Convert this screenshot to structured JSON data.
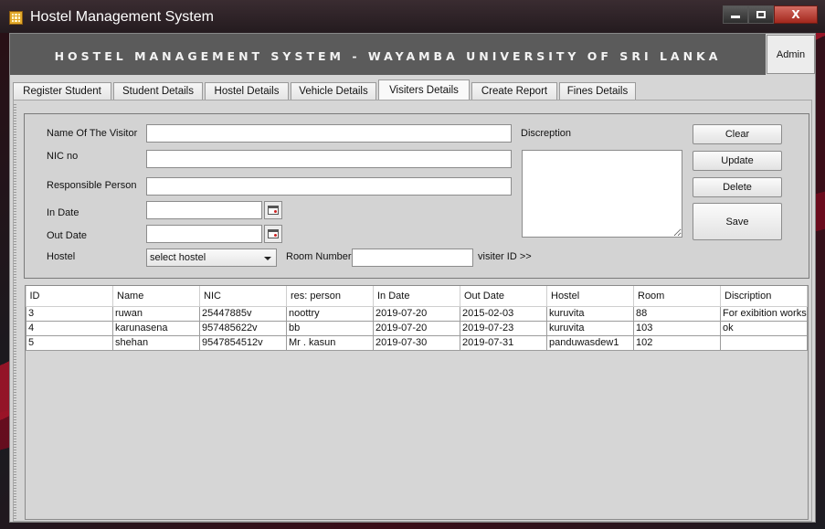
{
  "window": {
    "title": "Hostel Management System",
    "min_glyph": "",
    "max_glyph": "",
    "close_glyph": "X"
  },
  "banner": {
    "title": "HOSTEL MANAGEMENT SYSTEM - WAYAMBA UNIVERSITY OF SRI LANKA",
    "admin_label": "Admin"
  },
  "tabs": [
    {
      "label": "Register Student"
    },
    {
      "label": "Student Details"
    },
    {
      "label": "Hostel Details"
    },
    {
      "label": "Vehicle Details"
    },
    {
      "label": "Visiters Details",
      "active": true
    },
    {
      "label": "Create Report"
    },
    {
      "label": "Fines Details"
    }
  ],
  "form": {
    "visitor_name_label": "Name Of The Visitor",
    "visitor_name_value": "",
    "nic_label": "NIC no",
    "nic_value": "",
    "responsible_label": "Responsible Person",
    "responsible_value": "",
    "in_date_label": "In Date",
    "in_date_value": "",
    "out_date_label": "Out Date",
    "out_date_value": "",
    "hostel_label": "Hostel",
    "hostel_selected": "select hostel",
    "room_label": "Room Number",
    "room_value": "",
    "visitor_id_label": "visiter ID >>",
    "description_label": "Discreption",
    "description_value": ""
  },
  "buttons": {
    "clear": "Clear",
    "update": "Update",
    "delete": "Delete",
    "save": "Save"
  },
  "table": {
    "columns": [
      "ID",
      "Name",
      "NIC",
      "res: person",
      "In Date",
      "Out Date",
      "Hostel",
      "Room",
      "Discription"
    ],
    "rows": [
      [
        "3",
        "ruwan",
        "25447885v",
        "noottry",
        "2019-07-20",
        "2015-02-03",
        "kuruvita",
        "88",
        "For exibition works"
      ],
      [
        "4",
        "karunasena",
        "957485622v",
        "bb",
        "2019-07-20",
        "2019-07-23",
        "kuruvita",
        "103",
        "ok"
      ],
      [
        "5",
        "shehan",
        "9547854512v",
        "Mr . kasun",
        "2019-07-30",
        "2019-07-31",
        "panduwasdew1",
        "102",
        ""
      ]
    ]
  },
  "colors": {
    "banner_bg": "#5b5b5b",
    "panel_bg": "#d6d6d6",
    "close_red": "#c0392b"
  }
}
